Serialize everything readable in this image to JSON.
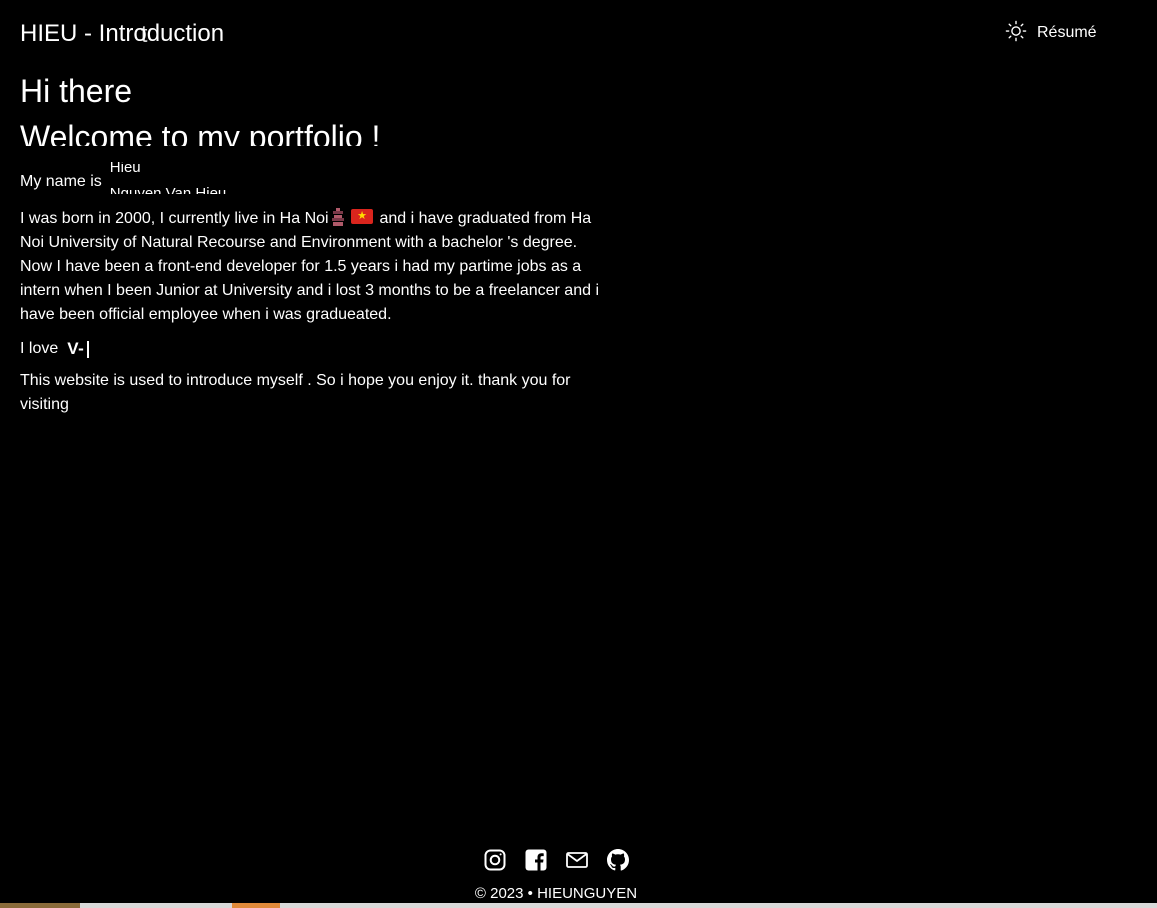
{
  "header": {
    "brand_prefix": "HIEU - In",
    "brand_glitch": "t",
    "brand_suffix": "troduction",
    "resume_label": "Résumé",
    "resume_icon": "sun-icon"
  },
  "hero": {
    "line1": "Hi there",
    "line2": "Welcome to my portfolio !"
  },
  "intro": {
    "name_label": "My name is",
    "name_options": [
      "Hieu",
      "Nguyen Van Hieu"
    ],
    "bio_part1": "I was born in 2000, I currently live in Ha Noi",
    "bio_part2": "and i have graduated from Ha Noi University of Natural Recourse and Environment with a bachelor 's degree. Now I have been a front-end developer for 1.5 years i had my partime jobs as a intern when I been Junior at University and i lost 3 months to be a freelancer and i have been official employee when i was gradueated.",
    "love_label": "I love",
    "love_typed": "V-",
    "closing": "This website is used to introduce myself . So i hope you enjoy it. thank you for visiting"
  },
  "footer": {
    "socials": [
      "instagram-icon",
      "facebook-icon",
      "mail-icon",
      "github-icon"
    ],
    "copyright": "© 2023 • HIEUNGUYEN"
  }
}
